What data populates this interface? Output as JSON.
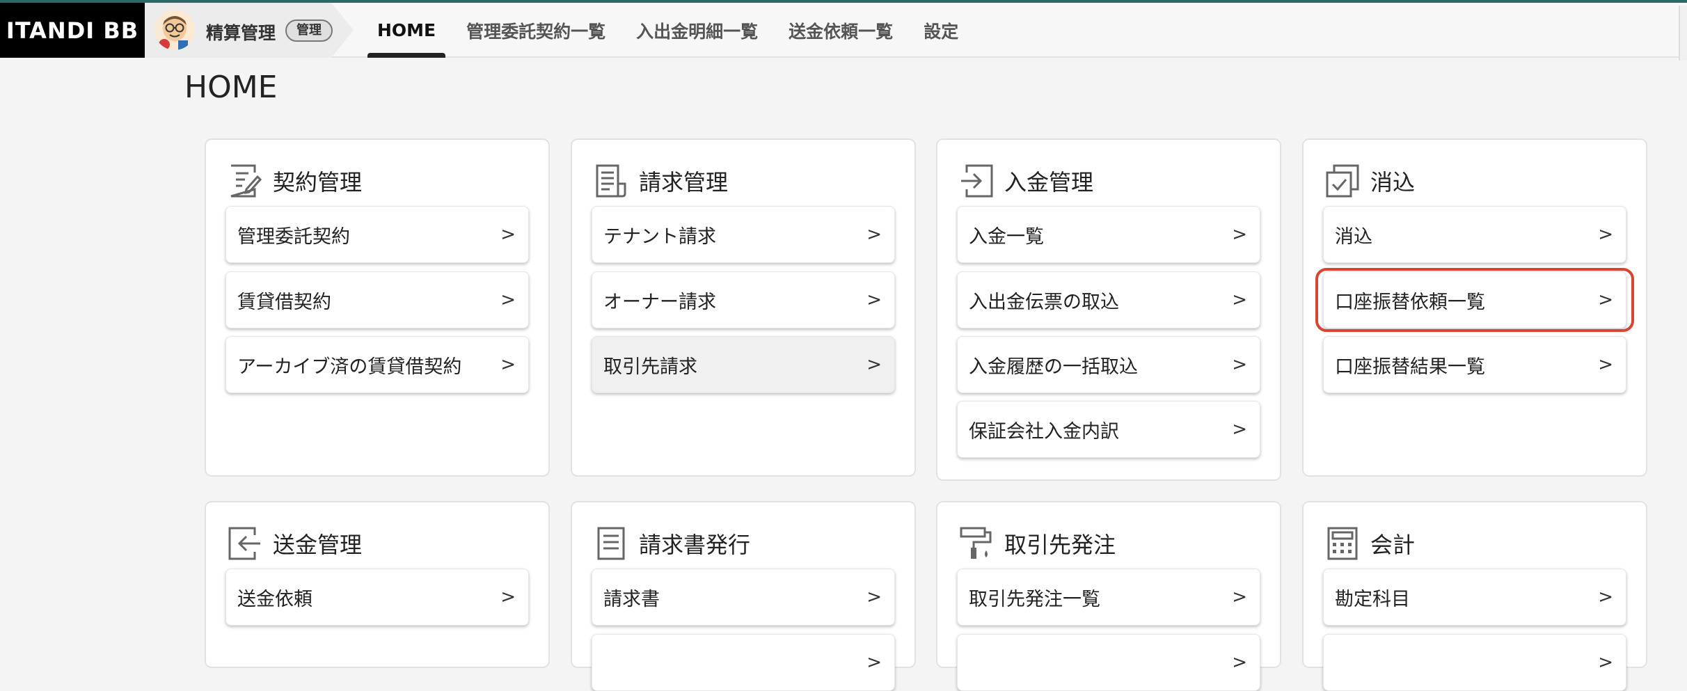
{
  "header": {
    "logo": "ITANDI BB",
    "app_name": "精算管理",
    "app_badge": "管理",
    "tabs": [
      "HOME",
      "管理委託契約一覧",
      "入出金明細一覧",
      "送金依頼一覧",
      "設定"
    ],
    "active_tab": "HOME"
  },
  "page": {
    "title": "HOME"
  },
  "colors": {
    "highlight": "#d94433",
    "logo_bg": "#000000",
    "topline": "#2c6868"
  },
  "sections": [
    {
      "title": "契約管理",
      "icon": "edit-list-icon",
      "items": [
        {
          "label": "管理委託契約"
        },
        {
          "label": "賃貸借契約"
        },
        {
          "label": "アーカイブ済の賃貸借契約"
        }
      ]
    },
    {
      "title": "請求管理",
      "icon": "invoice-icon",
      "items": [
        {
          "label": "テナント請求"
        },
        {
          "label": "オーナー請求"
        },
        {
          "label": "取引先請求",
          "selected": true
        }
      ]
    },
    {
      "title": "入金管理",
      "icon": "login-icon",
      "items": [
        {
          "label": "入金一覧"
        },
        {
          "label": "入出金伝票の取込"
        },
        {
          "label": "入金履歴の一括取込"
        },
        {
          "label": "保証会社入金内訳"
        }
      ]
    },
    {
      "title": "消込",
      "icon": "copy-check-icon",
      "items": [
        {
          "label": "消込"
        },
        {
          "label": "口座振替依頼一覧",
          "highlighted": true
        },
        {
          "label": "口座振替結果一覧"
        }
      ]
    },
    {
      "title": "送金管理",
      "icon": "logout-icon",
      "items": [
        {
          "label": "送金依頼"
        }
      ]
    },
    {
      "title": "請求書発行",
      "icon": "document-icon",
      "items": [
        {
          "label": "請求書"
        },
        {
          "label": ""
        }
      ]
    },
    {
      "title": "取引先発注",
      "icon": "paint-roller-icon",
      "items": [
        {
          "label": "取引先発注一覧"
        },
        {
          "label": ""
        }
      ]
    },
    {
      "title": "会計",
      "icon": "calculator-icon",
      "items": [
        {
          "label": "勘定科目"
        },
        {
          "label": ""
        }
      ]
    }
  ]
}
